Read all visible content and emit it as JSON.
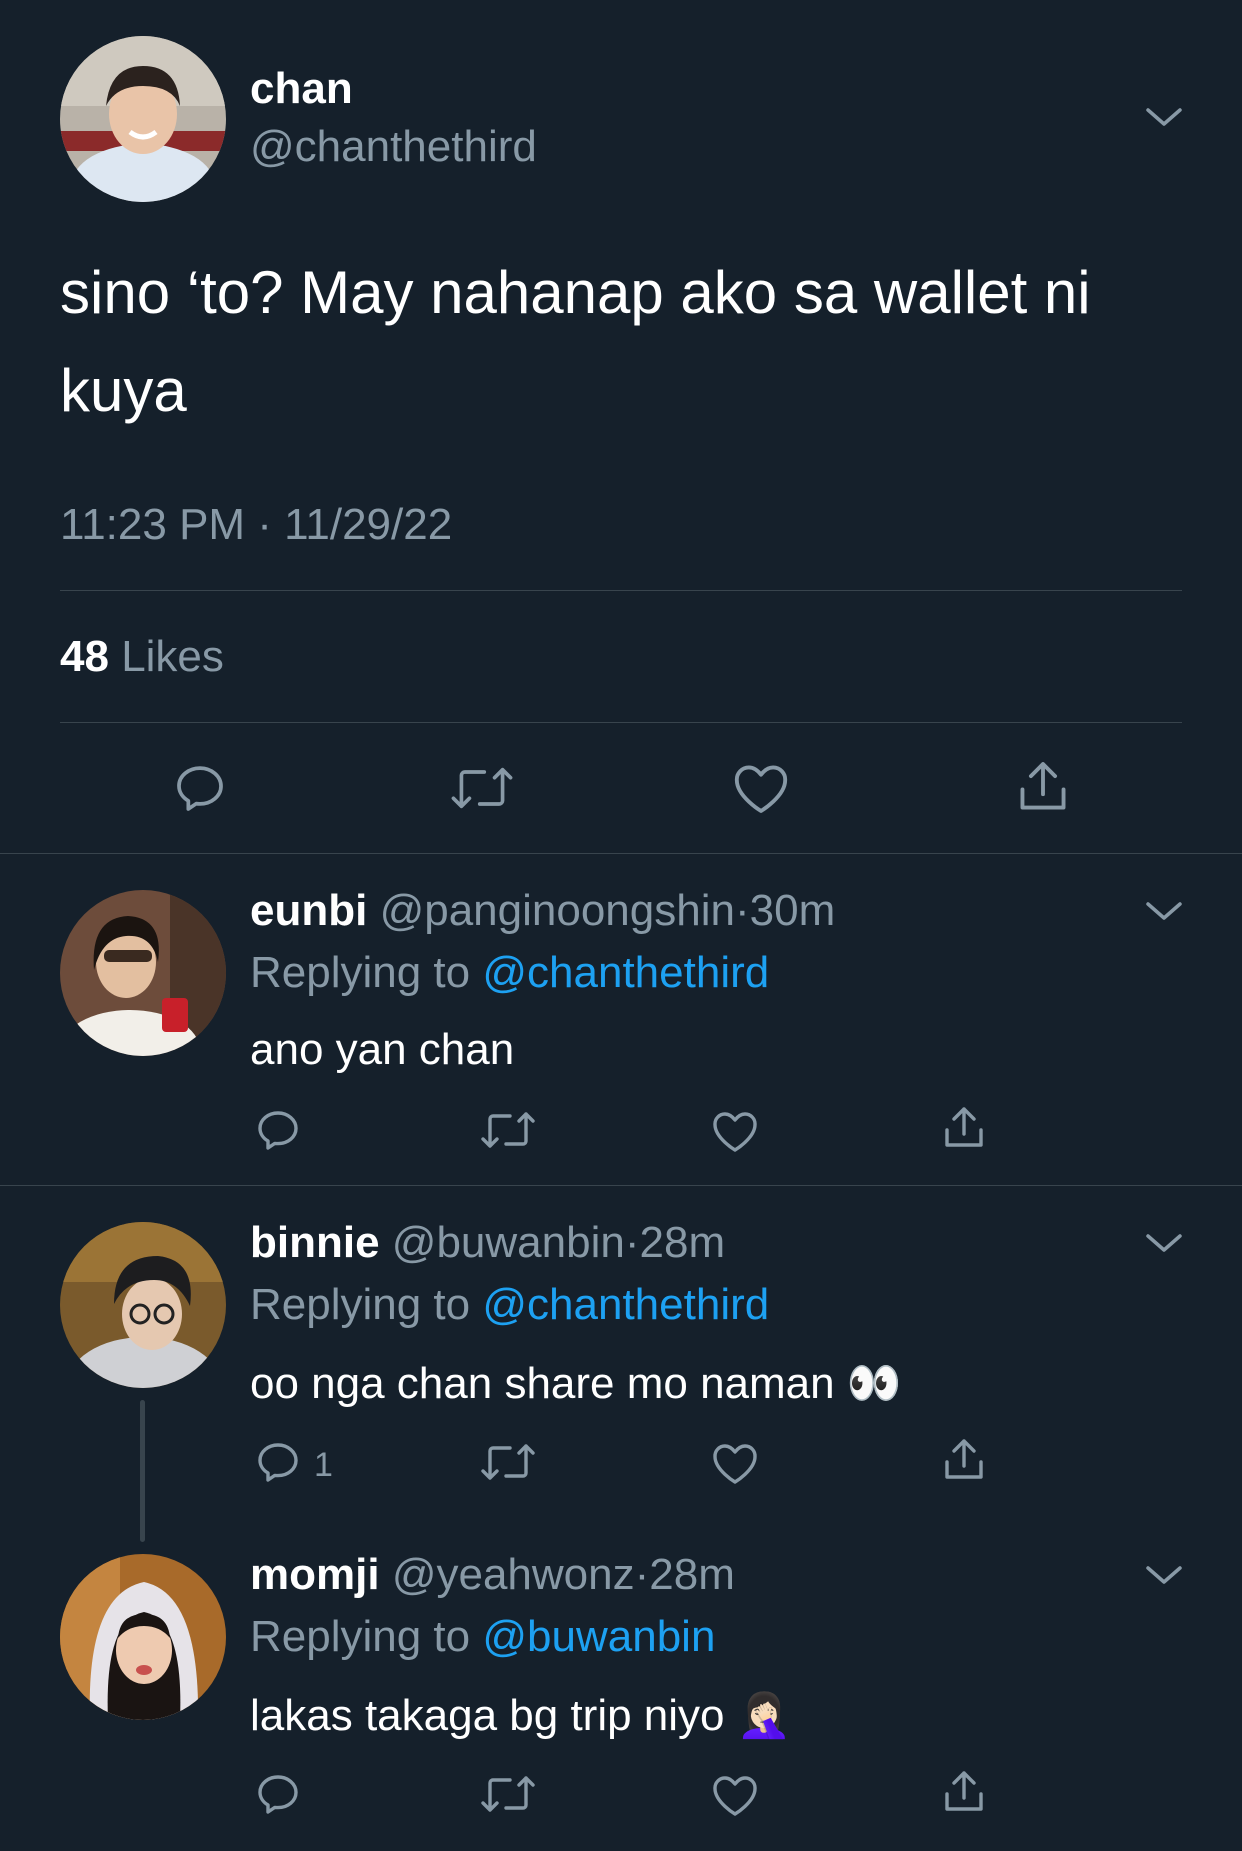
{
  "main_tweet": {
    "display_name": "chan",
    "handle": "@chanthethird",
    "text_line1": "sino ‘to? May nahanap ako sa wallet ni",
    "text_line2": "kuya",
    "timestamp": "11:23 PM · 11/29/22",
    "likes_count": "48",
    "likes_label": "Likes",
    "avatar_colors": {
      "bg": "#b9b2a8",
      "shirt": "#dde7f2",
      "hair": "#2b221e",
      "skin": "#e9c4a8"
    }
  },
  "replies": [
    {
      "display_name": "eunbi",
      "handle": "@panginoongshin",
      "separator": "·",
      "time": "30m",
      "replying_prefix": "Replying to",
      "replying_handle": "@chanthethird",
      "text": "ano yan chan",
      "reply_count": "",
      "avatar_colors": {
        "bg": "#6d4c3b",
        "shirt": "#f2efe9",
        "hair": "#1b1410",
        "skin": "#e3bfa0",
        "accent": "#c8202a"
      }
    },
    {
      "display_name": "binnie",
      "handle": "@buwanbin",
      "separator": "·",
      "time": "28m",
      "replying_prefix": "Replying to",
      "replying_handle": "@chanthethird",
      "text": "oo nga chan share mo naman",
      "emoji": "👀",
      "reply_count": "1",
      "avatar_colors": {
        "bg": "#7a5a2c",
        "shirt": "#cfd0d4",
        "hair": "#1d1d1f",
        "skin": "#e5c8b0"
      }
    },
    {
      "display_name": "momji",
      "handle": "@yeahwonz",
      "separator": "·",
      "time": "28m",
      "replying_prefix": "Replying to",
      "replying_handle": "@buwanbin",
      "text": "lakas takaga bg trip niyo",
      "emoji": "🤦🏻‍♀️",
      "reply_count": "",
      "avatar_colors": {
        "bg": "#a86a2a",
        "shirt": "#e6e3e8",
        "hair": "#1a1412",
        "skin": "#eecab0"
      }
    }
  ],
  "icons": [
    "reply-icon",
    "retweet-icon",
    "like-icon",
    "share-icon",
    "chevron-down-icon"
  ],
  "colors": {
    "background": "#15202b",
    "divider": "#38444d",
    "muted": "#8899a6",
    "link": "#1da1f2",
    "text": "#ffffff"
  }
}
